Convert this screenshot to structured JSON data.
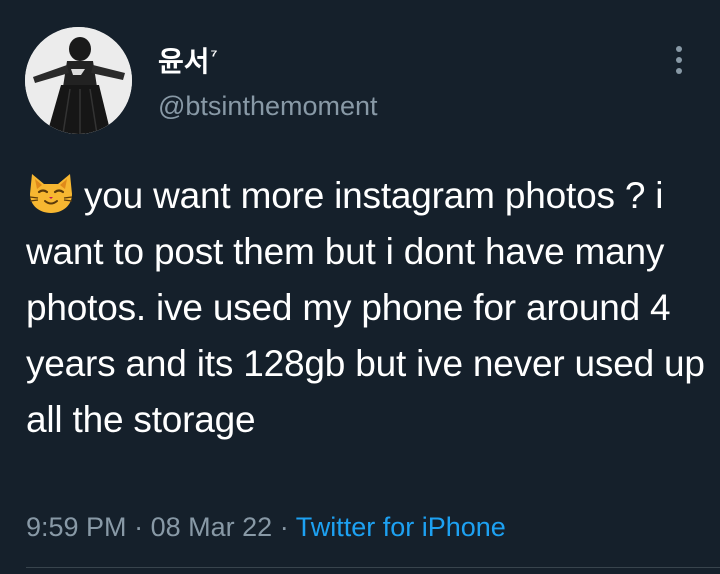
{
  "user": {
    "display_name": "윤서",
    "display_name_sup": "⁷",
    "handle": "@btsinthemoment"
  },
  "tweet": {
    "emoji": "smirking-cat-emoji",
    "text": "you want more instagram photos ? i want to post them but i dont have many photos. ive used my phone for around 4 years and its 128gb but ive never used up all the storage"
  },
  "meta": {
    "time": "9:59 PM",
    "separator": "·",
    "date": "08 Mar 22",
    "source": "Twitter for iPhone"
  },
  "icons": {
    "more": "more-vertical-icon"
  },
  "colors": {
    "background": "#15202b",
    "text": "#ffffff",
    "secondary": "#8899a6",
    "link": "#1da1f2",
    "divider": "#38444d"
  }
}
